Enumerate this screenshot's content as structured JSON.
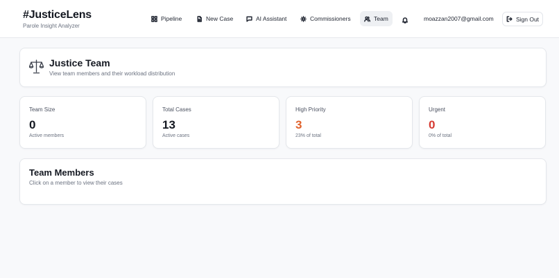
{
  "app": {
    "title": "#JusticeLens",
    "subtitle": "Parole Insight Analyzer"
  },
  "nav": {
    "items": [
      {
        "label": "Pipeline",
        "icon": "grid-icon"
      },
      {
        "label": "New Case",
        "icon": "document-icon"
      },
      {
        "label": "AI Assistant",
        "icon": "chat-icon"
      },
      {
        "label": "Commissioners",
        "icon": "settings-icon"
      },
      {
        "label": "Team",
        "icon": "users-icon",
        "active": true
      }
    ],
    "notification_icon": "bell-icon",
    "user_email": "moazzan2007@gmail.com",
    "sign_out_label": "Sign Out",
    "sign_out_icon": "logout-icon"
  },
  "page_header": {
    "icon": "scales-icon",
    "title": "Justice Team",
    "subtitle": "View team members and their workload distribution"
  },
  "stats": [
    {
      "label": "Team Size",
      "value": "0",
      "note": "Active members",
      "color": "#141821"
    },
    {
      "label": "Total Cases",
      "value": "13",
      "note": "Active cases",
      "color": "#141821"
    },
    {
      "label": "High Priority",
      "value": "3",
      "note": "23% of total",
      "color": "#e0622c"
    },
    {
      "label": "Urgent",
      "value": "0",
      "note": "0% of total",
      "color": "#d63a32"
    }
  ],
  "members": {
    "title": "Team Members",
    "subtitle": "Click on a member to view their cases"
  }
}
